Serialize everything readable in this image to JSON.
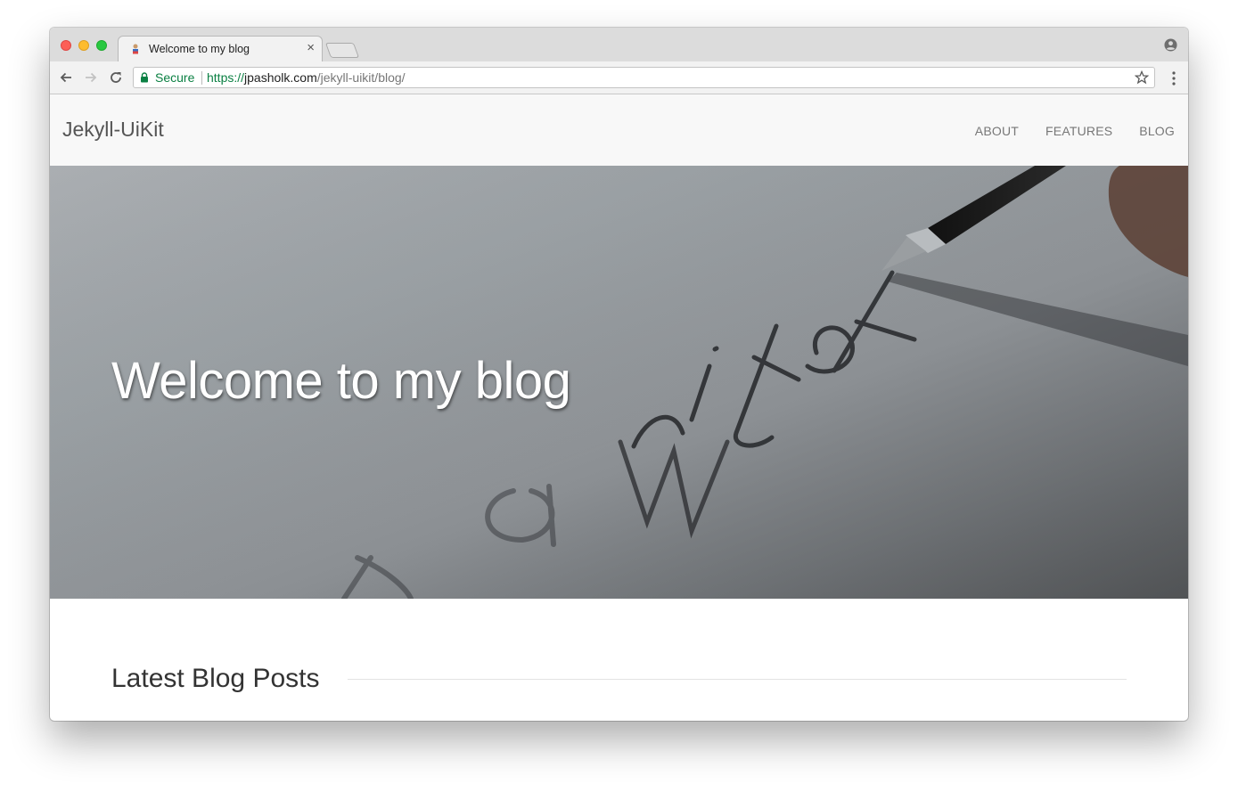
{
  "browser": {
    "tab_title": "Welcome to my blog",
    "tab_close": "×",
    "security_label": "Secure",
    "url": {
      "scheme": "https://",
      "host": "jpasholk.com",
      "path": "/jekyll-uikit/blog/"
    },
    "icons": [
      "back-arrow-icon",
      "forward-arrow-icon",
      "reload-icon",
      "lock-icon",
      "star-icon",
      "menu-dots-icon",
      "profile-icon"
    ]
  },
  "site": {
    "brand": "Jekyll-UiKit",
    "nav": [
      {
        "label": "ABOUT"
      },
      {
        "label": "FEATURES"
      },
      {
        "label": "BLOG"
      }
    ]
  },
  "hero": {
    "title": "Welcome to my blog"
  },
  "content": {
    "section_title": "Latest Blog Posts"
  },
  "colors": {
    "secure_green": "#0b8043",
    "navbar_bg": "#f8f8f8",
    "nav_link": "#777777",
    "brand_text": "#555555"
  }
}
